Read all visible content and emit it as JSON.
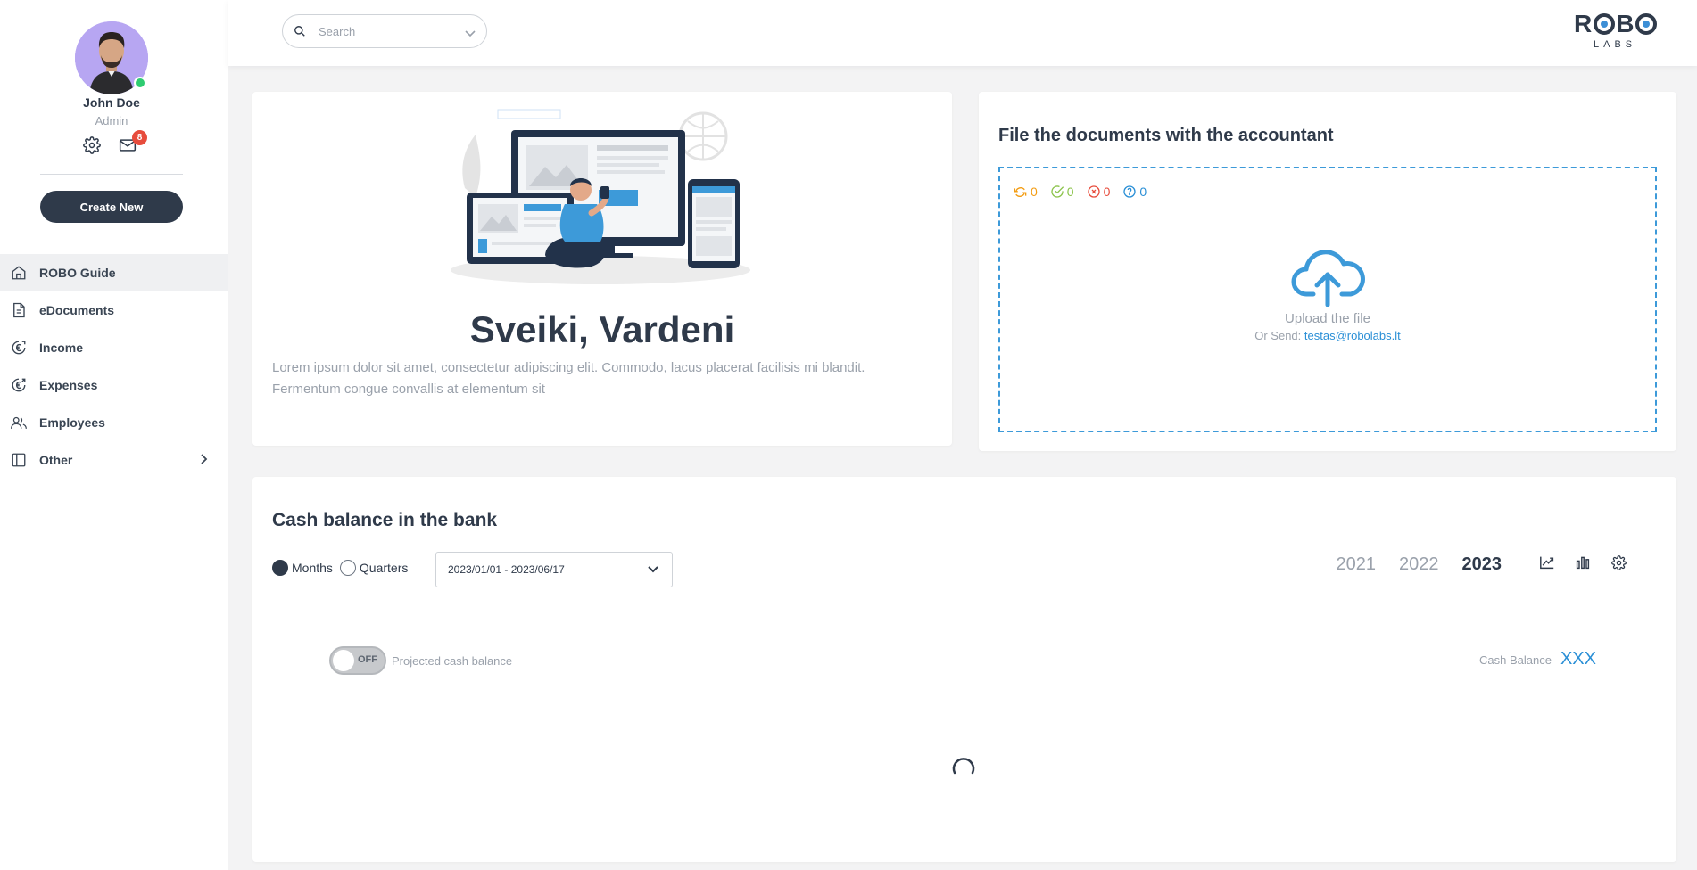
{
  "user": {
    "name": "John Doe",
    "role": "Admin",
    "notifications": "8",
    "status_color": "#2ecc71"
  },
  "sidebar": {
    "create_label": "Create New",
    "items": [
      {
        "label": "ROBO Guide",
        "icon": "home-icon"
      },
      {
        "label": "eDocuments",
        "icon": "document-icon"
      },
      {
        "label": "Income",
        "icon": "income-icon"
      },
      {
        "label": "Expenses",
        "icon": "expenses-icon"
      },
      {
        "label": "Employees",
        "icon": "users-icon"
      },
      {
        "label": "Other",
        "icon": "sidebar-panel-icon"
      }
    ]
  },
  "topbar": {
    "search_placeholder": "Search",
    "logo_top": [
      "R",
      "B"
    ],
    "logo_bottom": "LABS"
  },
  "welcome": {
    "title": "Sveiki, Vardeni",
    "text": "Lorem ipsum dolor sit amet, consectetur adipiscing elit. Commodo, lacus placerat facilisis mi blandit. Fermentum congue convallis at elementum sit"
  },
  "upload": {
    "title": "File the documents with the accountant",
    "stats": {
      "processing": "0",
      "done": "0",
      "failed": "0",
      "unknown": "0"
    },
    "stat_colors": {
      "processing": "#f39c12",
      "done": "#8bc34a",
      "failed": "#e74c3c",
      "unknown": "#2a8fd6"
    },
    "label": "Upload the file",
    "or_send_prefix": "Or Send:",
    "email": "testas@robolabs.lt"
  },
  "cash": {
    "title": "Cash balance in the bank",
    "radio_months": "Months",
    "radio_quarters": "Quarters",
    "date_range": "2023/01/01 - 2023/06/17",
    "years": [
      "2021",
      "2022",
      "2023"
    ],
    "active_year": "2023",
    "toggle_state": "OFF",
    "toggle_label": "Projected cash balance",
    "balance_label": "Cash Balance",
    "balance_value": "XXX"
  },
  "colors": {
    "primary": "#2f3a4a",
    "accent": "#2a8fd6",
    "muted": "#9aa1ab"
  }
}
